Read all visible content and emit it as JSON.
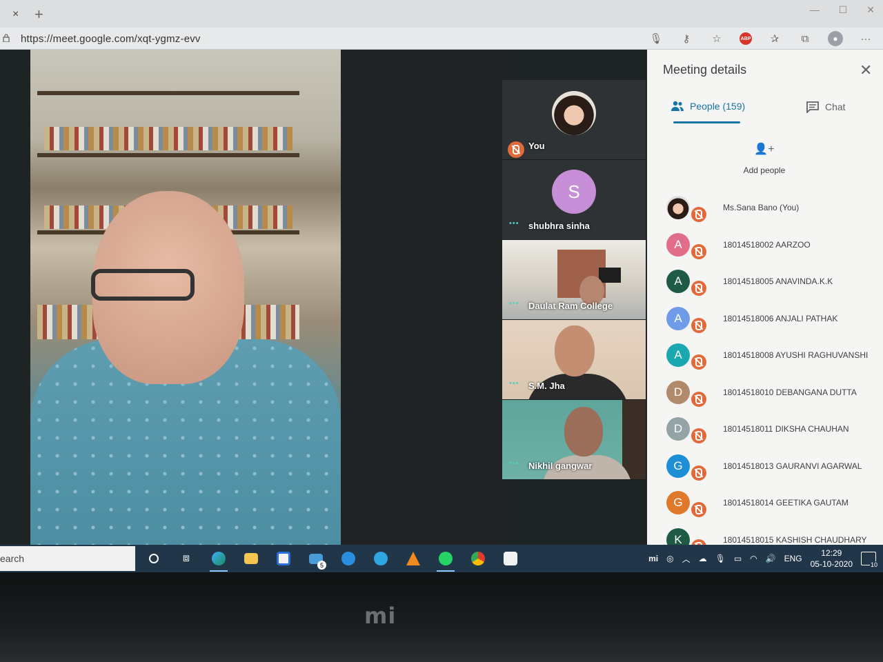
{
  "browser": {
    "tab_close": "×",
    "new_tab": "+",
    "url": "https://meet.google.com/xqt-ygmz-evv",
    "abp_label": "ABP"
  },
  "tiles": [
    {
      "name": "You",
      "avatar": "photo",
      "mic": "off"
    },
    {
      "name": "shubhra sinha",
      "avatar_letter": "S",
      "avatar_color": "#c88fd9"
    },
    {
      "name": "Daulat Ram College",
      "kind": "video"
    },
    {
      "name": "S.M. Jha",
      "kind": "video"
    },
    {
      "name": "Nikhil gangwar",
      "kind": "video"
    }
  ],
  "panel": {
    "title": "Meeting details",
    "tab_people": "People (159)",
    "tab_chat": "Chat",
    "add_people": "Add people",
    "people": [
      {
        "name": "Ms.Sana Bano (You)",
        "letter": "",
        "color": "photo"
      },
      {
        "name": "18014518002 AARZOO",
        "letter": "A",
        "color": "#e06d8a"
      },
      {
        "name": "18014518005 ANAVINDA.K.K",
        "letter": "A",
        "color": "#1f5a45"
      },
      {
        "name": "18014518006 ANJALI PATHAK",
        "letter": "A",
        "color": "#6f9be8"
      },
      {
        "name": "18014518008 AYUSHI RAGHUVANSHI",
        "letter": "A",
        "color": "#1ba8b0"
      },
      {
        "name": "18014518010 DEBANGANA DUTTA",
        "letter": "D",
        "color": "#b08a6a"
      },
      {
        "name": "18014518011 DIKSHA CHAUHAN",
        "letter": "D",
        "color": "#93a3a6"
      },
      {
        "name": "18014518013 GAURANVI AGARWAL",
        "letter": "G",
        "color": "#1e8fd6"
      },
      {
        "name": "18014518014 GEETIKA GAUTAM",
        "letter": "G",
        "color": "#e07a2a"
      },
      {
        "name": "18014518015 KASHISH CHAUDHARY",
        "letter": "K",
        "color": "#1f5a45"
      }
    ]
  },
  "taskbar": {
    "search_text": "earch",
    "mail_badge": "5",
    "tray_mi": "mi",
    "lang": "ENG",
    "time": "12:29",
    "date": "05-10-2020",
    "notifications": "10"
  },
  "bezel": {
    "logo": "mi"
  }
}
